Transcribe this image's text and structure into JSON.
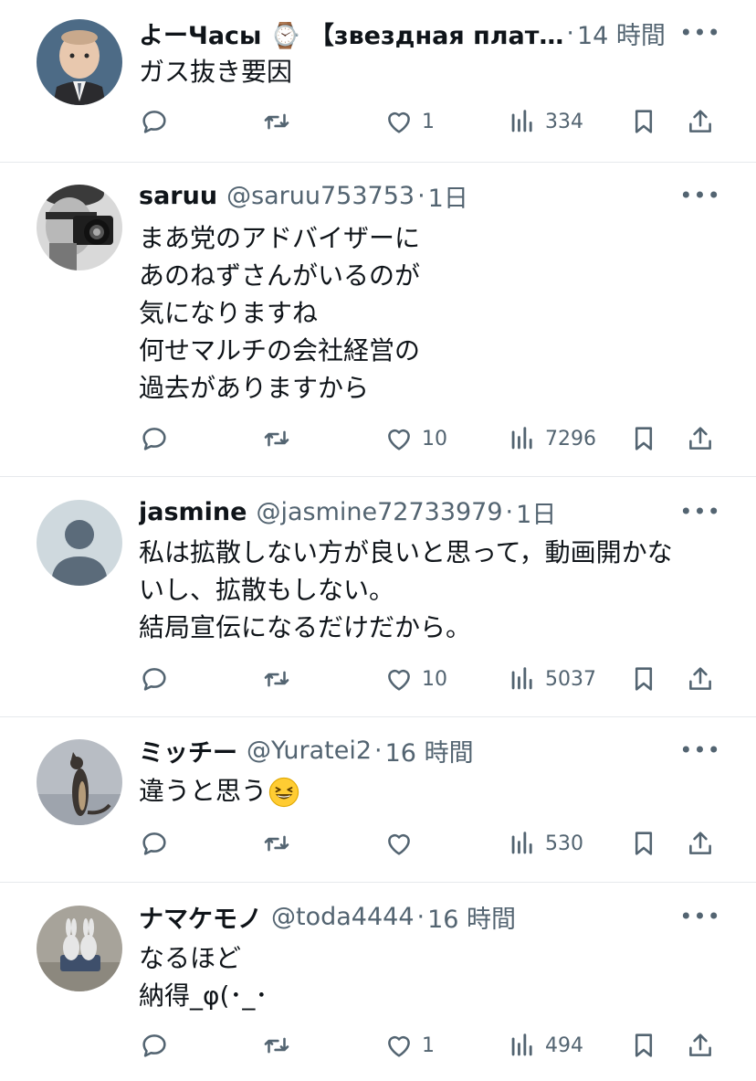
{
  "tweets": [
    {
      "name": "よーЧасы ⌚ 【звездная плат…",
      "handle": "",
      "sep": "·",
      "time": "14 時間",
      "lines": [
        "ガス抜き要因"
      ],
      "replies": "",
      "retweets": "",
      "likes": "1",
      "views": "334",
      "avatar": "baby-in-suit"
    },
    {
      "name": "saruu",
      "handle": "@saruu753753",
      "sep": "·",
      "time": "1日",
      "lines": [
        "まあ党のアドバイザーに",
        "あのねずさんがいるのが",
        "気になりますね",
        "何せマルチの会社経営の",
        "過去がありますから"
      ],
      "replies": "",
      "retweets": "",
      "likes": "10",
      "views": "7296",
      "avatar": "man-with-camera"
    },
    {
      "name": "jasmine",
      "handle": "@jasmine72733979",
      "sep": "·",
      "time": "1日",
      "lines": [
        "私は拡散しない方が良いと思って，動画開かな",
        "いし、拡散もしない。",
        "結局宣伝になるだけだから。"
      ],
      "replies": "",
      "retweets": "",
      "likes": "10",
      "views": "5037",
      "avatar": "default-person"
    },
    {
      "name": "ミッチー",
      "handle": "@Yuratei2",
      "sep": "·",
      "time": "16 時間",
      "lines": [
        "違うと思う"
      ],
      "emoji": "grinning-squinting-face",
      "replies": "",
      "retweets": "",
      "likes": "",
      "views": "530",
      "avatar": "cat-silhouette"
    },
    {
      "name": "ナマケモノ",
      "handle": "@toda4444",
      "sep": "·",
      "time": "16 時間",
      "lines": [
        "なるほど",
        "納得_φ(･_･"
      ],
      "replies": "",
      "retweets": "",
      "likes": "1",
      "views": "494",
      "avatar": "rabbit-figurines"
    }
  ],
  "more_label": "•••",
  "colors": {
    "text": "#0f1419",
    "muted": "#536471",
    "divider": "#e6e9ec"
  }
}
